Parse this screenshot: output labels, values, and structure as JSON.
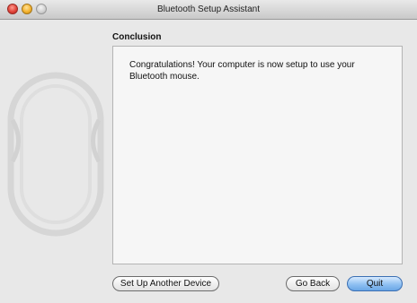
{
  "window": {
    "title": "Bluetooth Setup Assistant"
  },
  "sidebar": {
    "illustration_icon": "bluetooth-mouse-icon"
  },
  "main": {
    "heading": "Conclusion",
    "message": "Congratulations! Your computer is now setup to use your Bluetooth mouse."
  },
  "buttons": {
    "setup_another": "Set Up Another Device",
    "go_back": "Go Back",
    "quit": "Quit"
  },
  "colors": {
    "window_background": "#e8e8e8",
    "content_background": "#f6f6f6",
    "default_button": "#8fc0f2"
  }
}
